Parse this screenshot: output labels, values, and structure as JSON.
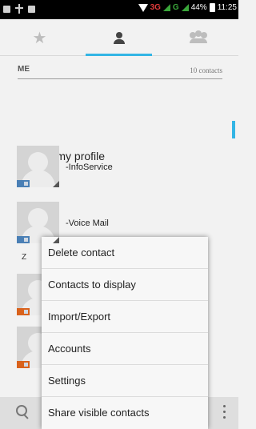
{
  "status_bar": {
    "network_1": "3G",
    "network_2": "G",
    "battery": "44%",
    "time": "11:25"
  },
  "tabs": [
    {
      "name": "favorites",
      "icon": "star-icon",
      "selected": false
    },
    {
      "name": "contacts",
      "icon": "person-icon",
      "selected": true
    },
    {
      "name": "groups",
      "icon": "group-icon",
      "selected": false
    }
  ],
  "accent_color": "#33b5e5",
  "list": {
    "section_label": "ME",
    "contact_count": "10 contacts",
    "profile_label": "Set up my profile",
    "contacts": [
      {
        "name": "-InfoService"
      },
      {
        "name": "-Voice Mail"
      }
    ],
    "index_letter": "Z"
  },
  "menu": {
    "items": [
      "Delete contact",
      "Contacts to display",
      "Import/Export",
      "Accounts",
      "Settings",
      "Share visible contacts"
    ]
  }
}
